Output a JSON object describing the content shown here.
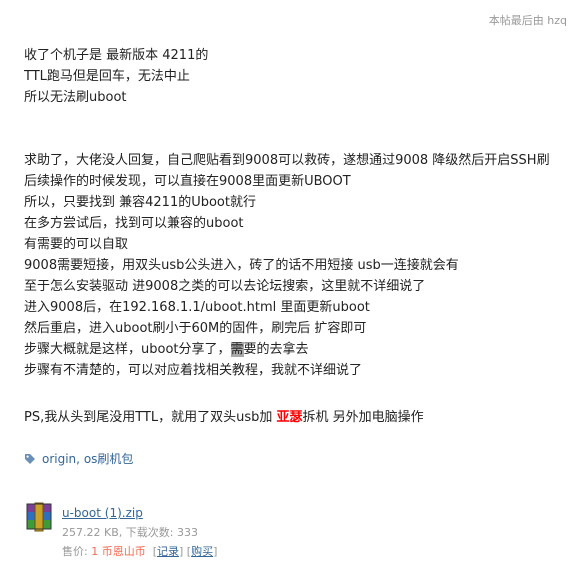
{
  "last_edit": "本帖最后由 hzq",
  "paragraph1": [
    "收了个机子是 最新版本 4211的",
    "TTL跑马但是回车，无法中止",
    "所以无法刷uboot"
  ],
  "paragraph2": [
    "求助了，大佬没人回复，自己爬贴看到9008可以救砖，遂想通过9008 降级然后开启SSH刷",
    "后续操作的时候发现，可以直接在9008里面更新UBOOT",
    "所以，只要找到 兼容4211的Uboot就行",
    "在多方尝试后，找到可以兼容的uboot",
    "有需要的可以自取",
    "9008需要短接，用双头usb公头进入，砖了的话不用短接 usb一连接就会有",
    "至于怎么安装驱动 进9008之类的可以去论坛搜索，这里就不详细说了",
    "进入9008后，在192.168.1.1/uboot.html 里面更新uboot",
    "然后重启，进入uboot刷小于60M的固件，刷完后 扩容即可"
  ],
  "line_share": {
    "before": "步骤大概就是这样，uboot分享了，",
    "highlight": "需",
    "after": "要的去拿去"
  },
  "line_last": "步骤有不清楚的，可以对应着找相关教程，我就不详细说了",
  "ps": {
    "before": "PS,我从头到尾没用TTL，就用了双头usb加 ",
    "red": "亚瑟",
    "after": "拆机 另外加电脑操作"
  },
  "tags": {
    "tag1": "origin",
    "sep": ", ",
    "tag2": "os刷机包"
  },
  "attachment": {
    "icon": "rar-archive-icon",
    "name": "u-boot (1).zip",
    "meta": "257.22 KB, 下载次数: 333",
    "price_label": "售价: ",
    "price_value": "1 币恩山币",
    "record_label": "记录",
    "buy_label": "购买"
  }
}
